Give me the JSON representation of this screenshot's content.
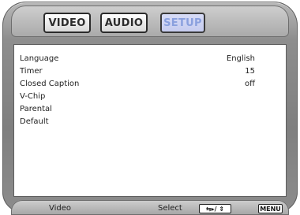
{
  "tabs": [
    {
      "label": "VIDEO"
    },
    {
      "label": "AUDIO"
    },
    {
      "label": "SETUP"
    }
  ],
  "menu": {
    "rows": [
      {
        "label": "Language",
        "value": "English"
      },
      {
        "label": "Timer",
        "value": "15"
      },
      {
        "label": "Closed Caption",
        "value": "off"
      },
      {
        "label": "V-Chip",
        "value": ""
      },
      {
        "label": "Parental",
        "value": ""
      },
      {
        "label": "Default",
        "value": ""
      }
    ]
  },
  "footer": {
    "left_label": "Video",
    "center_label": "Select",
    "nav_key": "⇆▸/ ⇕",
    "menu_key": "MENU"
  },
  "colors": {
    "active_tab_bg": "#c6ccef",
    "active_tab_text": "#8aa0de"
  }
}
